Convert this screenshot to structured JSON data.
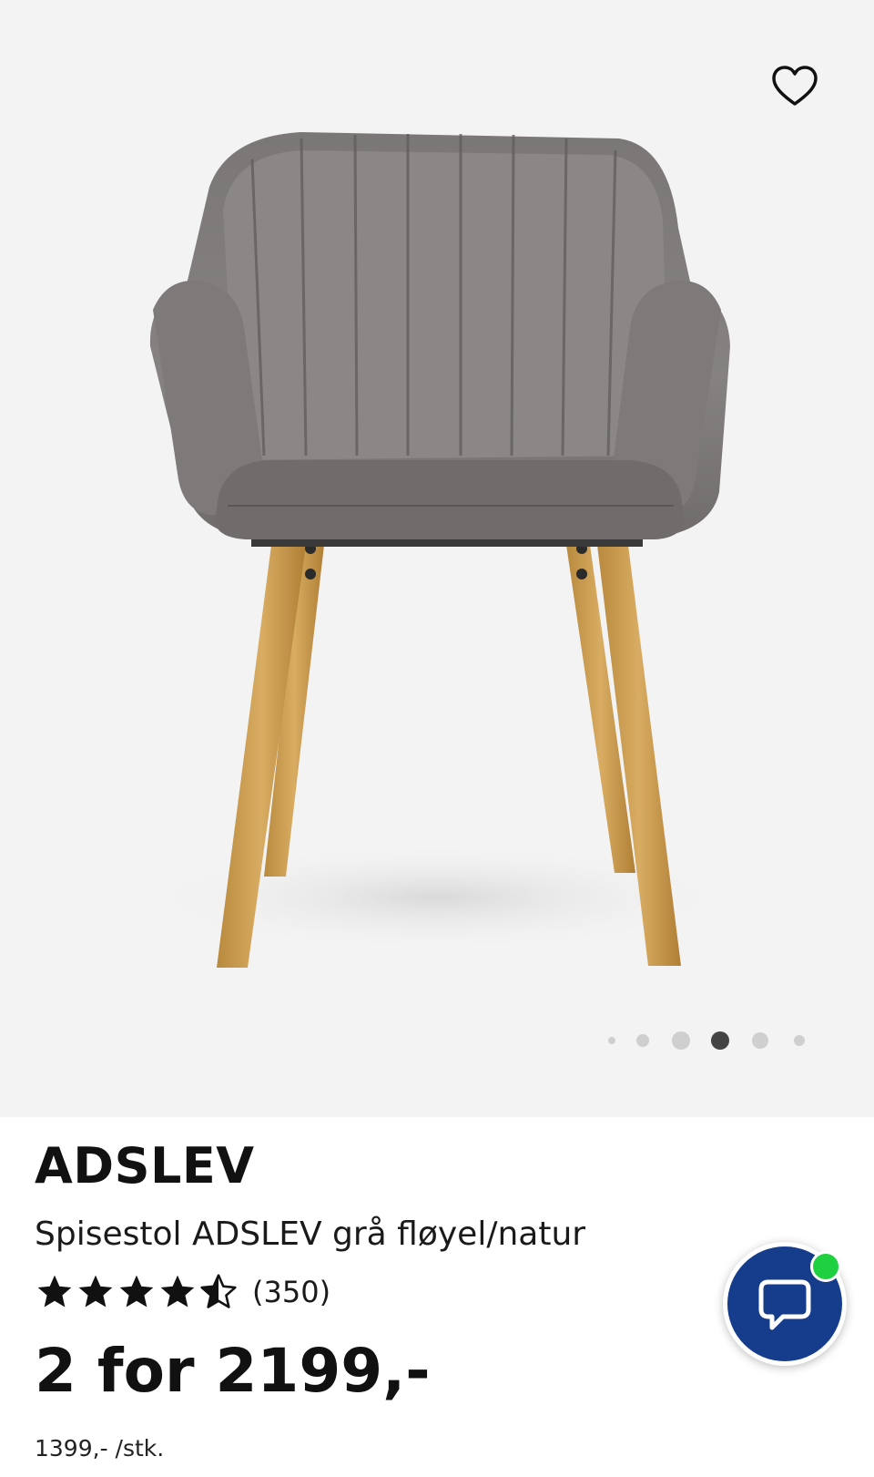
{
  "gallery": {
    "image_alt": "Spisestol ADSLEV grå fløyel/natur",
    "favorite_icon": "heart-outline-icon",
    "slide_count": 6,
    "active_slide": 4
  },
  "product": {
    "brand": "ADSLEV",
    "subtitle": "Spisestol ADSLEV grå fløyel/natur",
    "rating": 4.5,
    "rating_max": 5,
    "review_count": "(350)",
    "price": "2 for 2199,-",
    "unit_price": "1399,- /stk."
  },
  "chat": {
    "icon": "chat-bubble-icon",
    "status": "online",
    "button_color": "#163c8c",
    "status_color": "#1fd140"
  }
}
